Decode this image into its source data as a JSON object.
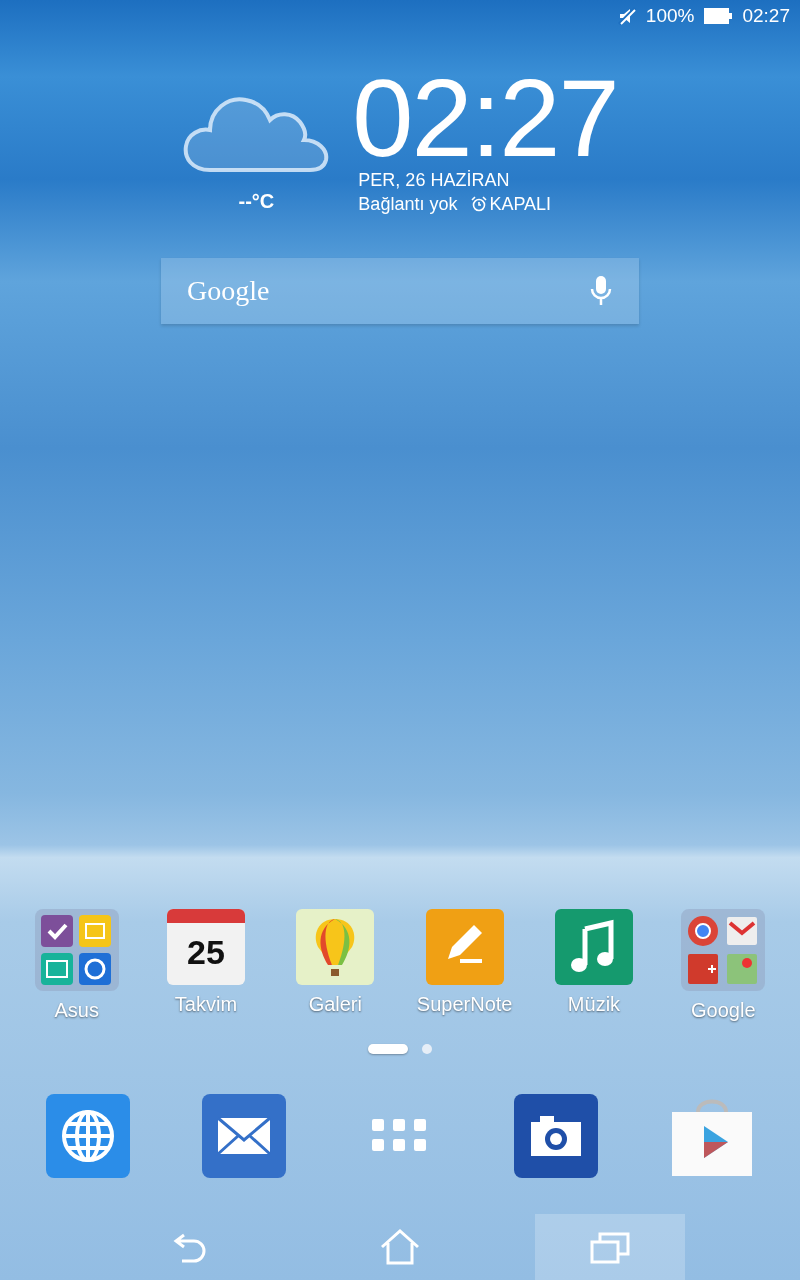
{
  "status_bar": {
    "battery": "100%",
    "time": "02:27"
  },
  "clock_widget": {
    "time": "02:27",
    "date": "PER, 26 HAZİRAN",
    "connection": "Bağlantı yok",
    "alarm": "KAPALI",
    "temperature": "--°C"
  },
  "search": {
    "logo": "Google"
  },
  "apps": [
    {
      "kind": "asusfolder",
      "label": "Asus"
    },
    {
      "kind": "calendar",
      "label": "Takvim",
      "day": "25"
    },
    {
      "kind": "gallery",
      "label": "Galeri"
    },
    {
      "kind": "notes",
      "label": "SuperNote"
    },
    {
      "kind": "music",
      "label": "Müzik"
    },
    {
      "kind": "googlefolder",
      "label": "Google"
    }
  ],
  "pages": [
    {
      "selected": true
    },
    {
      "selected": false
    }
  ],
  "dock": [
    {
      "kind": "browser"
    },
    {
      "kind": "mail"
    },
    {
      "kind": "apps"
    },
    {
      "kind": "camera"
    },
    {
      "kind": "store"
    }
  ],
  "nav": [
    {
      "kind": "back",
      "pressed": false
    },
    {
      "kind": "home",
      "pressed": false
    },
    {
      "kind": "recents",
      "pressed": true
    }
  ]
}
